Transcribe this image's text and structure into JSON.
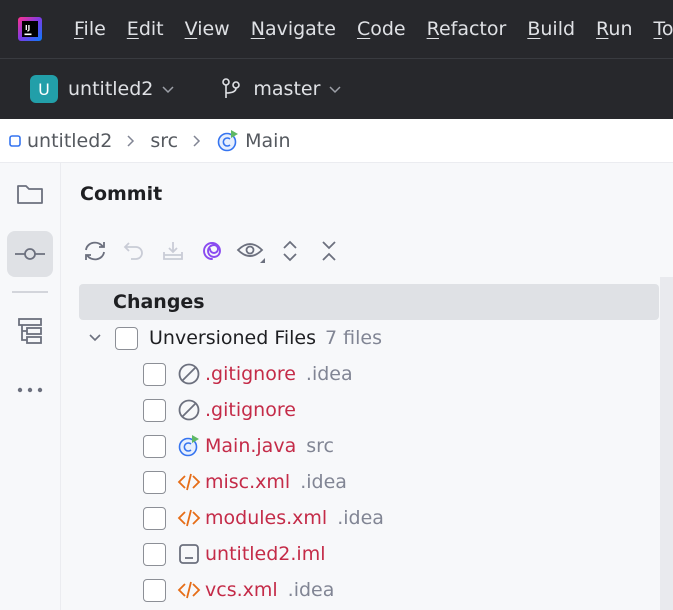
{
  "menu": {
    "items": [
      {
        "mnemonic": "F",
        "rest": "ile"
      },
      {
        "mnemonic": "E",
        "rest": "dit"
      },
      {
        "mnemonic": "V",
        "rest": "iew"
      },
      {
        "mnemonic": "N",
        "rest": "avigate"
      },
      {
        "mnemonic": "C",
        "rest": "ode"
      },
      {
        "mnemonic": "R",
        "rest": "efactor"
      },
      {
        "mnemonic": "B",
        "rest": "uild"
      },
      {
        "mnemonic": "R",
        "rest": "un"
      },
      {
        "mnemonic": "T",
        "rest": "ools"
      }
    ]
  },
  "toolbar": {
    "project_initial": "U",
    "project_name": "untitled2",
    "branch": "master",
    "avatar_color": "#229fa9"
  },
  "breadcrumb": {
    "items": [
      "untitled2",
      "src",
      "Main"
    ]
  },
  "toolstrip": {
    "icons": [
      "project-folder-icon",
      "commit-icon",
      "structure-icon",
      "more-icon"
    ]
  },
  "commit": {
    "title": "Commit",
    "actions": [
      "refresh-icon",
      "rollback-icon",
      "shelve-icon",
      "ai-commit-icon",
      "preview-diff-icon",
      "expand-all-icon",
      "collapse-all-icon"
    ],
    "changes_label": "Changes",
    "group": {
      "label": "Unversioned Files",
      "count": "7 files"
    },
    "files": [
      {
        "name": ".gitignore",
        "location": ".idea",
        "icon": "ignore-icon"
      },
      {
        "name": ".gitignore",
        "location": "",
        "icon": "ignore-icon"
      },
      {
        "name": "Main.java",
        "location": "src",
        "icon": "java-class-icon"
      },
      {
        "name": "misc.xml",
        "location": ".idea",
        "icon": "xml-icon"
      },
      {
        "name": "modules.xml",
        "location": ".idea",
        "icon": "xml-icon"
      },
      {
        "name": "untitled2.iml",
        "location": "",
        "icon": "iml-icon"
      },
      {
        "name": "vcs.xml",
        "location": ".idea",
        "icon": "xml-icon"
      }
    ]
  },
  "colors": {
    "unversioned_file": "#c42b48",
    "header_bg": "#27282c",
    "selection_bg": "#dfe1e5"
  }
}
